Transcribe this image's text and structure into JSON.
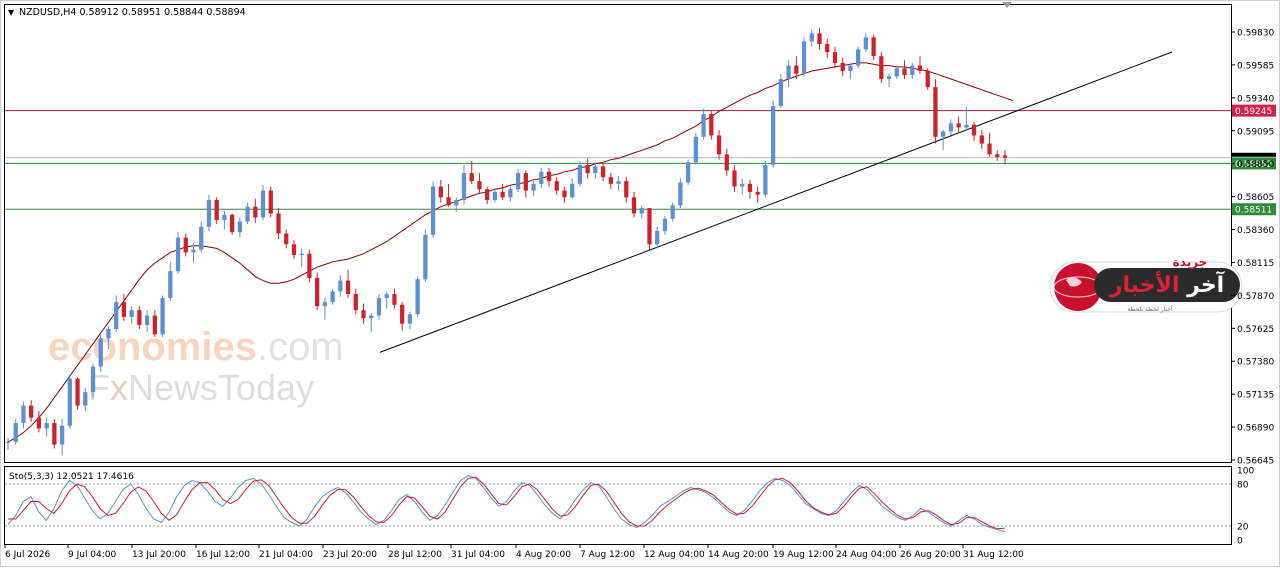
{
  "chart_data": {
    "type": "candlestick",
    "symbol_header": "NZDUSD,H4  0.58912 0.58951 0.58844 0.58894",
    "ylim": [
      0.56645,
      0.59955
    ],
    "y_ticks": [
      "0.59830",
      "0.59585",
      "0.59340",
      "0.59095",
      "0.58850",
      "0.58605",
      "0.58360",
      "0.58115",
      "0.57870",
      "0.57625",
      "0.57380",
      "0.57135",
      "0.56890",
      "0.56645"
    ],
    "x_ticks": [
      "6 Jul 2026",
      "9 Jul 04:00",
      "13 Jul 20:00",
      "16 Jul 12:00",
      "21 Jul 04:00",
      "23 Jul 20:00",
      "28 Jul 12:00",
      "31 Jul 04:00",
      "4 Aug 20:00",
      "7 Aug 12:00",
      "12 Aug 04:00",
      "14 Aug 20:00",
      "19 Aug 12:00",
      "24 Aug 04:00",
      "26 Aug 20:00",
      "31 Aug 12:00"
    ],
    "horizontal_levels": [
      {
        "value": 0.59245,
        "label": "0.59245",
        "color": "#8b1a4a",
        "tag_color": "#d0204e"
      },
      {
        "value": 0.58852,
        "label": "0.58852",
        "color": "#2e8b3a",
        "tag_color": "#2e8b3a"
      },
      {
        "value": 0.58511,
        "label": "0.58511",
        "color": "#2e8b3a",
        "tag_color": "#2e8b3a"
      }
    ],
    "current_price": 0.58894,
    "trendline": {
      "from": [
        0.05,
        0.57595
      ],
      "to": [
        0.82,
        0.59575
      ],
      "color": "#000000"
    },
    "moving_average_color": "#8b0000",
    "colors": {
      "up": "#5b8fd6",
      "down": "#d0202a"
    },
    "ohlc": [
      [
        0.5678,
        0.5681,
        0.5672,
        0.5678
      ],
      [
        0.5678,
        0.5695,
        0.5676,
        0.5692
      ],
      [
        0.5692,
        0.5708,
        0.5688,
        0.5705
      ],
      [
        0.5705,
        0.5709,
        0.5693,
        0.5696
      ],
      [
        0.5696,
        0.5701,
        0.5685,
        0.5688
      ],
      [
        0.5688,
        0.5696,
        0.5682,
        0.5692
      ],
      [
        0.5692,
        0.5695,
        0.5673,
        0.5676
      ],
      [
        0.5676,
        0.5695,
        0.5668,
        0.569
      ],
      [
        0.569,
        0.5728,
        0.5688,
        0.5725
      ],
      [
        0.5725,
        0.5726,
        0.5702,
        0.5705
      ],
      [
        0.5705,
        0.5718,
        0.5701,
        0.5715
      ],
      [
        0.5715,
        0.5736,
        0.5711,
        0.5734
      ],
      [
        0.5734,
        0.5758,
        0.573,
        0.5755
      ],
      [
        0.5755,
        0.5764,
        0.5747,
        0.5762
      ],
      [
        0.5762,
        0.5787,
        0.576,
        0.5782
      ],
      [
        0.5782,
        0.5788,
        0.5768,
        0.5771
      ],
      [
        0.5771,
        0.5779,
        0.5766,
        0.5776
      ],
      [
        0.5776,
        0.5779,
        0.5762,
        0.5765
      ],
      [
        0.5765,
        0.5776,
        0.576,
        0.5772
      ],
      [
        0.5772,
        0.5776,
        0.5756,
        0.5758
      ],
      [
        0.5758,
        0.5787,
        0.5756,
        0.5785
      ],
      [
        0.5785,
        0.5812,
        0.5783,
        0.5805
      ],
      [
        0.5805,
        0.5834,
        0.5803,
        0.583
      ],
      [
        0.583,
        0.5833,
        0.5816,
        0.5819
      ],
      [
        0.5819,
        0.5826,
        0.5811,
        0.5821
      ],
      [
        0.5821,
        0.5842,
        0.5819,
        0.5838
      ],
      [
        0.5838,
        0.5862,
        0.5835,
        0.5858
      ],
      [
        0.5858,
        0.586,
        0.584,
        0.5843
      ],
      [
        0.5843,
        0.585,
        0.5836,
        0.5847
      ],
      [
        0.5847,
        0.5848,
        0.5832,
        0.5834
      ],
      [
        0.5834,
        0.5845,
        0.583,
        0.5842
      ],
      [
        0.5842,
        0.5856,
        0.584,
        0.5853
      ],
      [
        0.5853,
        0.5859,
        0.5841,
        0.5845
      ],
      [
        0.5845,
        0.5869,
        0.5843,
        0.5865
      ],
      [
        0.5865,
        0.5868,
        0.5845,
        0.5848
      ],
      [
        0.5848,
        0.5852,
        0.5829,
        0.5833
      ],
      [
        0.5833,
        0.5836,
        0.5822,
        0.5825
      ],
      [
        0.5825,
        0.5828,
        0.5814,
        0.5817
      ],
      [
        0.5817,
        0.5822,
        0.5808,
        0.5818
      ],
      [
        0.5818,
        0.5821,
        0.5797,
        0.58
      ],
      [
        0.58,
        0.5804,
        0.5776,
        0.5779
      ],
      [
        0.5779,
        0.5785,
        0.5769,
        0.5782
      ],
      [
        0.5782,
        0.5792,
        0.578,
        0.579
      ],
      [
        0.579,
        0.5802,
        0.5786,
        0.5798
      ],
      [
        0.5798,
        0.5806,
        0.5785,
        0.5788
      ],
      [
        0.5788,
        0.5792,
        0.5773,
        0.5776
      ],
      [
        0.5776,
        0.5781,
        0.5766,
        0.577
      ],
      [
        0.577,
        0.5774,
        0.576,
        0.5772
      ],
      [
        0.5772,
        0.5788,
        0.5769,
        0.5785
      ],
      [
        0.5785,
        0.579,
        0.5777,
        0.5788
      ],
      [
        0.5788,
        0.5792,
        0.5777,
        0.578
      ],
      [
        0.578,
        0.5782,
        0.5761,
        0.5766
      ],
      [
        0.5766,
        0.5775,
        0.5762,
        0.5773
      ],
      [
        0.5773,
        0.5801,
        0.5771,
        0.5799
      ],
      [
        0.5799,
        0.5836,
        0.5797,
        0.5832
      ],
      [
        0.5832,
        0.5872,
        0.583,
        0.5868
      ],
      [
        0.5868,
        0.5873,
        0.5856,
        0.586
      ],
      [
        0.586,
        0.587,
        0.5853,
        0.5854
      ],
      [
        0.5854,
        0.586,
        0.5849,
        0.5858
      ],
      [
        0.5858,
        0.5884,
        0.5855,
        0.5878
      ],
      [
        0.5878,
        0.5887,
        0.587,
        0.5872
      ],
      [
        0.5872,
        0.5878,
        0.5863,
        0.5866
      ],
      [
        0.5866,
        0.5868,
        0.5855,
        0.5858
      ],
      [
        0.5858,
        0.5866,
        0.5856,
        0.5864
      ],
      [
        0.5864,
        0.587,
        0.5858,
        0.586
      ],
      [
        0.586,
        0.5868,
        0.5857,
        0.5866
      ],
      [
        0.5866,
        0.5881,
        0.5864,
        0.5878
      ],
      [
        0.5878,
        0.588,
        0.586,
        0.5865
      ],
      [
        0.5865,
        0.5872,
        0.5861,
        0.587
      ],
      [
        0.587,
        0.5882,
        0.5867,
        0.5879
      ],
      [
        0.5879,
        0.5882,
        0.5868,
        0.5872
      ],
      [
        0.5872,
        0.5875,
        0.5862,
        0.5865
      ],
      [
        0.5865,
        0.5868,
        0.5856,
        0.586
      ],
      [
        0.586,
        0.5874,
        0.5859,
        0.587
      ],
      [
        0.587,
        0.5887,
        0.5868,
        0.5884
      ],
      [
        0.5884,
        0.5889,
        0.5874,
        0.5878
      ],
      [
        0.5878,
        0.5886,
        0.5874,
        0.5883
      ],
      [
        0.5883,
        0.5885,
        0.5872,
        0.5875
      ],
      [
        0.5875,
        0.5878,
        0.5866,
        0.587
      ],
      [
        0.587,
        0.5876,
        0.5865,
        0.5872
      ],
      [
        0.5872,
        0.5875,
        0.5856,
        0.586
      ],
      [
        0.586,
        0.5864,
        0.5845,
        0.5848
      ],
      [
        0.5848,
        0.5854,
        0.5844,
        0.5852
      ],
      [
        0.5852,
        0.5852,
        0.582,
        0.5825
      ],
      [
        0.5825,
        0.5838,
        0.5822,
        0.5835
      ],
      [
        0.5835,
        0.5846,
        0.5832,
        0.5844
      ],
      [
        0.5844,
        0.5856,
        0.5842,
        0.5854
      ],
      [
        0.5854,
        0.5874,
        0.5852,
        0.5871
      ],
      [
        0.5871,
        0.5888,
        0.5869,
        0.5886
      ],
      [
        0.5886,
        0.5908,
        0.5884,
        0.5905
      ],
      [
        0.5905,
        0.5926,
        0.5903,
        0.5922
      ],
      [
        0.5922,
        0.5924,
        0.5903,
        0.5906
      ],
      [
        0.5906,
        0.591,
        0.5888,
        0.5892
      ],
      [
        0.5892,
        0.5896,
        0.5876,
        0.588
      ],
      [
        0.588,
        0.5884,
        0.5864,
        0.5868
      ],
      [
        0.5868,
        0.5874,
        0.5862,
        0.587
      ],
      [
        0.587,
        0.5873,
        0.5859,
        0.5864
      ],
      [
        0.5864,
        0.5868,
        0.5856,
        0.5862
      ],
      [
        0.5862,
        0.5887,
        0.586,
        0.5884
      ],
      [
        0.5884,
        0.5932,
        0.5882,
        0.5928
      ],
      [
        0.5928,
        0.5952,
        0.5926,
        0.5948
      ],
      [
        0.5948,
        0.5962,
        0.5942,
        0.5958
      ],
      [
        0.5958,
        0.5965,
        0.5948,
        0.5952
      ],
      [
        0.5952,
        0.5979,
        0.595,
        0.5976
      ],
      [
        0.5976,
        0.5985,
        0.5972,
        0.5982
      ],
      [
        0.5982,
        0.5986,
        0.597,
        0.5974
      ],
      [
        0.5974,
        0.5978,
        0.5964,
        0.5968
      ],
      [
        0.5968,
        0.5972,
        0.5956,
        0.596
      ],
      [
        0.596,
        0.5964,
        0.595,
        0.5954
      ],
      [
        0.5954,
        0.596,
        0.5948,
        0.5958
      ],
      [
        0.5958,
        0.5972,
        0.5956,
        0.597
      ],
      [
        0.597,
        0.5982,
        0.5968,
        0.5979
      ],
      [
        0.5979,
        0.5981,
        0.5962,
        0.5965
      ],
      [
        0.5965,
        0.5968,
        0.5945,
        0.5948
      ],
      [
        0.5948,
        0.5952,
        0.5942,
        0.595
      ],
      [
        0.595,
        0.5958,
        0.5948,
        0.5956
      ],
      [
        0.5956,
        0.5962,
        0.5948,
        0.5951
      ],
      [
        0.5951,
        0.596,
        0.5948,
        0.5958
      ],
      [
        0.5958,
        0.5965,
        0.5952,
        0.5954
      ],
      [
        0.5954,
        0.5956,
        0.594,
        0.5942
      ],
      [
        0.5942,
        0.5948,
        0.59,
        0.5905
      ],
      [
        0.5905,
        0.591,
        0.5895,
        0.5909
      ],
      [
        0.5909,
        0.5918,
        0.5906,
        0.5915
      ],
      [
        0.5915,
        0.592,
        0.5908,
        0.5912
      ],
      [
        0.5912,
        0.5927,
        0.591,
        0.5914
      ],
      [
        0.5914,
        0.5916,
        0.5902,
        0.5906
      ],
      [
        0.5906,
        0.591,
        0.5896,
        0.59
      ],
      [
        0.59,
        0.5908,
        0.589,
        0.5892
      ],
      [
        0.5892,
        0.5895,
        0.5887,
        0.589
      ],
      [
        0.58912,
        0.58951,
        0.58844,
        0.58894
      ]
    ],
    "ma": [
      0.5678,
      0.5681,
      0.5685,
      0.569,
      0.5696,
      0.5703,
      0.5711,
      0.5719,
      0.5727,
      0.5735,
      0.5743,
      0.5751,
      0.5759,
      0.5767,
      0.5775,
      0.5783,
      0.5791,
      0.5799,
      0.5806,
      0.5811,
      0.5815,
      0.5819,
      0.5821,
      0.5823,
      0.5824,
      0.5824,
      0.5823,
      0.5822,
      0.5819,
      0.5815,
      0.5811,
      0.5806,
      0.5801,
      0.5798,
      0.5796,
      0.5796,
      0.5797,
      0.5799,
      0.5802,
      0.5805,
      0.5808,
      0.581,
      0.5812,
      0.5813,
      0.5814,
      0.5816,
      0.5818,
      0.5821,
      0.5824,
      0.5827,
      0.5831,
      0.5835,
      0.5839,
      0.5843,
      0.5847,
      0.585,
      0.5853,
      0.5855,
      0.5857,
      0.5859,
      0.5861,
      0.5863,
      0.5864,
      0.5866,
      0.5867,
      0.5869,
      0.587,
      0.5871,
      0.5873,
      0.5874,
      0.5876,
      0.5877,
      0.5879,
      0.588,
      0.5882,
      0.5883,
      0.5885,
      0.5886,
      0.5888,
      0.5889,
      0.5891,
      0.5893,
      0.5895,
      0.5897,
      0.5899,
      0.5902,
      0.5904,
      0.5907,
      0.591,
      0.5913,
      0.5917,
      0.592,
      0.5924,
      0.5927,
      0.593,
      0.5933,
      0.5936,
      0.5938,
      0.5941,
      0.5943,
      0.5946,
      0.5948,
      0.595,
      0.5952,
      0.5954,
      0.5955,
      0.5956,
      0.5957,
      0.5958,
      0.5959,
      0.596,
      0.596,
      0.5959,
      0.5958,
      0.5958,
      0.5957,
      0.5957,
      0.5956,
      0.5955,
      0.5954,
      0.5952,
      0.595,
      0.5948,
      0.5946,
      0.5944,
      0.5942,
      0.594,
      0.5938,
      0.5936,
      0.5934,
      0.5932
    ],
    "oscillator": {
      "label": "Sto(5,3,3) 12.0521 17.4616",
      "levels": [
        "100",
        "80",
        "20",
        "0"
      ],
      "ylim": [
        0,
        100
      ],
      "series": [
        {
          "values": [
            22,
            35,
            55,
            62,
            40,
            28,
            45,
            70,
            85,
            78,
            60,
            42,
            30,
            38,
            55,
            72,
            80,
            65,
            45,
            30,
            25,
            40,
            62,
            78,
            85,
            82,
            70,
            55,
            48,
            60,
            75,
            85,
            88,
            80,
            65,
            48,
            32,
            25,
            20,
            30,
            48,
            62,
            70,
            75,
            68,
            55,
            40,
            30,
            22,
            28,
            42,
            58,
            65,
            55,
            40,
            28,
            35,
            50,
            68,
            85,
            92,
            88,
            75,
            60,
            48,
            55,
            70,
            82,
            78,
            65,
            50,
            38,
            30,
            42,
            58,
            72,
            82,
            78,
            62,
            45,
            30,
            22,
            18,
            25,
            35,
            48,
            55,
            62,
            70,
            75,
            72,
            68,
            60,
            50,
            40,
            35,
            42,
            55,
            70,
            82,
            88,
            85,
            78,
            65,
            52,
            45,
            38,
            35,
            42,
            55,
            68,
            78,
            72,
            60,
            48,
            40,
            32,
            28,
            35,
            45,
            40,
            32,
            25,
            20,
            28,
            35,
            30,
            22,
            18,
            15,
            12
          ]
        },
        {
          "values": [
            30,
            30,
            42,
            55,
            55,
            45,
            38,
            52,
            70,
            80,
            76,
            62,
            45,
            35,
            38,
            52,
            68,
            76,
            70,
            55,
            38,
            28,
            36,
            55,
            72,
            82,
            82,
            72,
            58,
            52,
            58,
            72,
            84,
            86,
            78,
            62,
            46,
            32,
            24,
            24,
            34,
            50,
            64,
            72,
            72,
            62,
            48,
            35,
            26,
            25,
            35,
            50,
            62,
            60,
            48,
            34,
            30,
            40,
            58,
            76,
            88,
            90,
            80,
            66,
            52,
            50,
            62,
            76,
            80,
            72,
            58,
            44,
            34,
            36,
            48,
            64,
            78,
            80,
            70,
            54,
            38,
            26,
            20,
            20,
            28,
            40,
            50,
            58,
            66,
            72,
            74,
            70,
            64,
            54,
            44,
            37,
            38,
            48,
            62,
            76,
            86,
            88,
            82,
            70,
            56,
            46,
            40,
            36,
            38,
            48,
            62,
            74,
            76,
            66,
            54,
            44,
            35,
            30,
            32,
            40,
            42,
            36,
            28,
            22,
            24,
            32,
            32,
            26,
            20,
            16,
            17
          ]
        }
      ]
    }
  }
}
